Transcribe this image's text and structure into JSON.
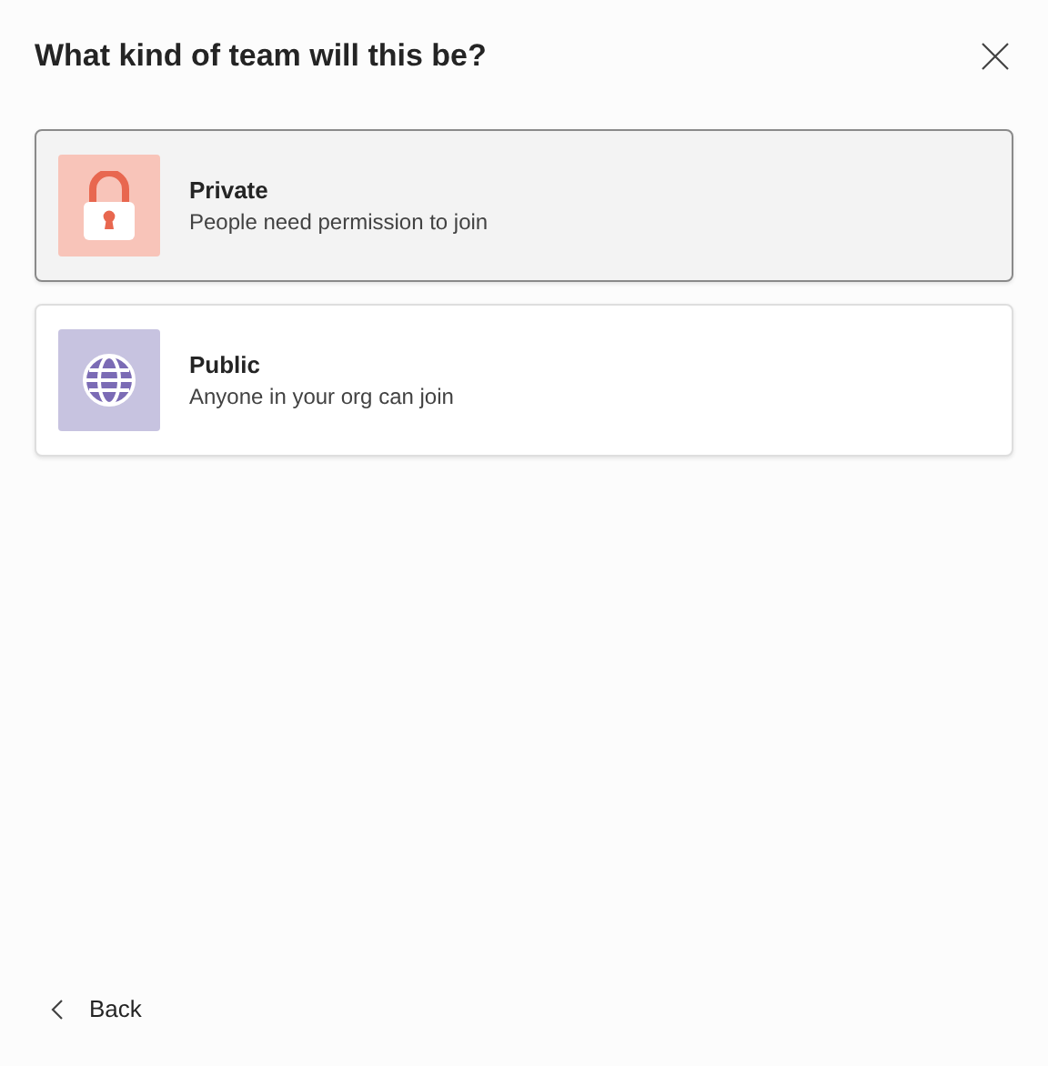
{
  "dialog": {
    "title": "What kind of team will this be?"
  },
  "options": [
    {
      "kind": "private",
      "title": "Private",
      "description": "People need permission to join",
      "selected": true
    },
    {
      "kind": "public",
      "title": "Public",
      "description": "Anyone in your org can join",
      "selected": false
    }
  ],
  "footer": {
    "back_label": "Back"
  }
}
